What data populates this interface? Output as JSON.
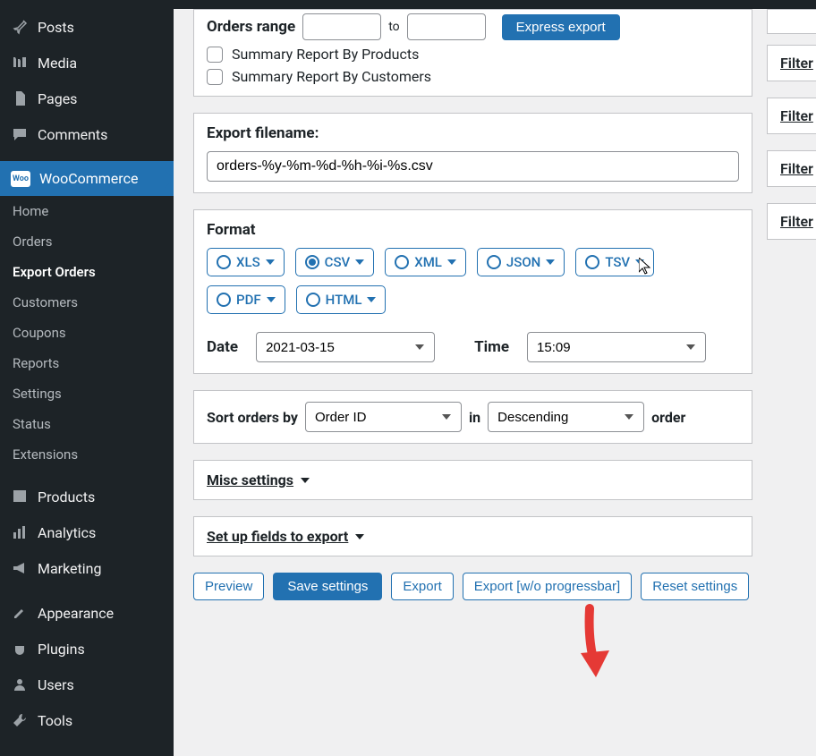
{
  "sidebar": {
    "items": [
      {
        "label": "Posts"
      },
      {
        "label": "Media"
      },
      {
        "label": "Pages"
      },
      {
        "label": "Comments"
      },
      {
        "label": "WooCommerce",
        "badge": "Woo"
      }
    ],
    "sub": [
      {
        "label": "Home"
      },
      {
        "label": "Orders"
      },
      {
        "label": "Export Orders"
      },
      {
        "label": "Customers"
      },
      {
        "label": "Coupons"
      },
      {
        "label": "Reports"
      },
      {
        "label": "Settings"
      },
      {
        "label": "Status"
      },
      {
        "label": "Extensions"
      }
    ],
    "items2": [
      {
        "label": "Products"
      },
      {
        "label": "Analytics"
      },
      {
        "label": "Marketing"
      }
    ],
    "items3": [
      {
        "label": "Appearance"
      },
      {
        "label": "Plugins"
      },
      {
        "label": "Users"
      },
      {
        "label": "Tools"
      }
    ]
  },
  "orders_range_label": "Orders range",
  "to_label": "to",
  "express_export": "Express export",
  "summary_products": "Summary Report By Products",
  "summary_customers": "Summary Report By Customers",
  "export_filename_label": "Export filename:",
  "export_filename_value": "orders-%y-%m-%d-%h-%i-%s.csv",
  "format_label": "Format",
  "formats": [
    {
      "name": "XLS"
    },
    {
      "name": "CSV"
    },
    {
      "name": "XML"
    },
    {
      "name": "JSON"
    },
    {
      "name": "TSV"
    },
    {
      "name": "PDF"
    },
    {
      "name": "HTML"
    }
  ],
  "date_label": "Date",
  "date_value": "2021-03-15",
  "time_label": "Time",
  "time_value": "15:09",
  "sort_by_label": "Sort orders by",
  "sort_by_value": "Order ID",
  "in_label": "in",
  "sort_dir_value": "Descending",
  "order_label": "order",
  "misc_label": "Misc settings",
  "setup_fields_label": "Set up fields to export ",
  "buttons": {
    "preview": "Preview",
    "save": "Save settings",
    "export": "Export",
    "export_wo": "Export [w/o progressbar]",
    "reset": "Reset settings"
  },
  "filter_link": "Filter"
}
